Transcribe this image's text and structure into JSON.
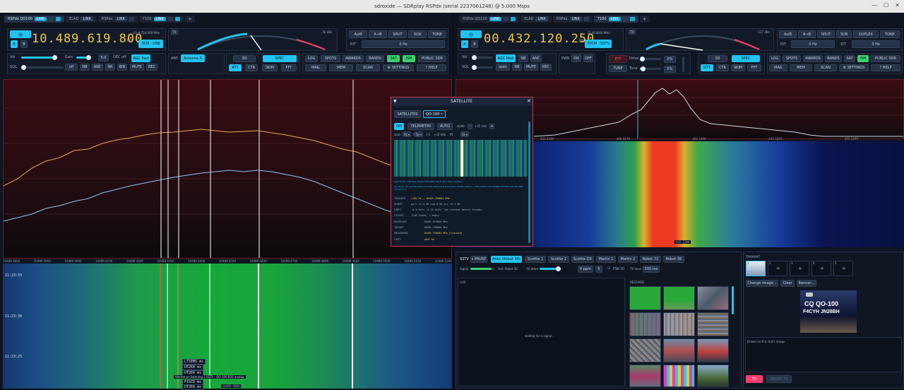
{
  "window": {
    "title": "sdroxide — SDRplay RSPdx (serial 2237061248) @ 5.000 Msps"
  },
  "left": {
    "tabs": [
      {
        "label": "RSPdx QO100",
        "link": "LINK",
        "active": true
      },
      {
        "label": "ELAD",
        "link": "LINK",
        "active": false
      },
      {
        "label": "RSPdx",
        "link": "LINK",
        "active": false
      },
      {
        "label": "7100",
        "link": "LINK",
        "active": false
      }
    ],
    "add_tab": "+",
    "vfo_a": "A",
    "vfo_b": "B",
    "frequency": "10.489.619.800",
    "freq_unit": "Hz",
    "sub_freq": "LO: 9.750.000 MHz",
    "tx_badge": "TX",
    "smeter_value": "-56 dBs",
    "band_button": "3CM · USB",
    "ab_buttons": [
      "A⇄B",
      "A→B",
      "SPLIT",
      "SUB",
      "TONE"
    ],
    "rit_label": "RIT",
    "rit_value": "0 Hz",
    "vol_label": "Vol",
    "gain_label": "Gain",
    "gain_value": "6.0",
    "dec_label": "DEC off",
    "agc_button": "AGC Fast",
    "sql_label": "SQL",
    "sql_value": "off",
    "nb": "NB",
    "anc": "ANC",
    "nr": "NR",
    "bin": "BIN",
    "mute": "MUTE",
    "rec": "REC",
    "ant_label": "ANT",
    "ant_button": "Antenna A",
    "view_buttons": [
      "3D",
      "SPEC",
      "RTT",
      "CTR",
      "SKIM",
      "FFT"
    ],
    "right_buttons": [
      "LOG",
      "SPOTS",
      "AWARDS",
      "BANDS",
      "SAT",
      "ISM",
      "PUBLIC SDR",
      "MAIL",
      "MEM",
      "SCAN",
      "⚙ SETTINGS",
      "? HELP"
    ],
    "spectrum_ticks": [
      "10489.3800",
      "10489.3900",
      "10489.4000",
      "10489.4100",
      "10489.4200",
      "10489.4300",
      "10489.4400",
      "10489.4500",
      "10489.4600",
      "10489.4700",
      "10489.4800",
      "10489.4900",
      "10489.5000",
      "10489.5100",
      "10489.5200"
    ],
    "time_labels": [
      "11:23:33",
      "11:23:30",
      "11:23:25"
    ],
    "spot_labels": [
      "LT1EMS ms",
      "UT2EA ms",
      "UT2EA ms",
      "F1SCD ms",
      "UT2EA ms",
      "UT2EA ms"
    ],
    "spot_tooltip": "Warten on listening 1 SSTV · QO-100 B20 analog",
    "cursor_readout": "10489.5000"
  },
  "right": {
    "tabs": [
      {
        "label": "RSPdx QO100",
        "link": "LINK",
        "active": false
      },
      {
        "label": "ELAD",
        "link": "LINK",
        "active": false
      },
      {
        "label": "RSPdx",
        "link": "LINK",
        "active": false
      },
      {
        "label": "7100",
        "link": "LINK",
        "active": true
      }
    ],
    "add_tab": "+",
    "vfo_a": "A",
    "vfo_b": "B",
    "frequency": "00.432.120.250",
    "freq_unit": "Hz",
    "sub_freq": "51.874000 MHz",
    "tx_badge": "TX",
    "smeter_value": "-127 dBs",
    "band_button": "70CM · SSTV",
    "ab_buttons": [
      "A⇄B",
      "A→B",
      "SPLIT",
      "SUB",
      "DUPLEX",
      "TONE"
    ],
    "rit_label": "RIT",
    "rit_value": "0 Hz",
    "xit_label": "XIT",
    "xit_value": "0 Hz",
    "vol_label": "Vol",
    "agc_button": "AGC Mod",
    "sql_label": "SQL",
    "sql_value": "open",
    "nb": "NB",
    "anc": "ANC",
    "mute": "MUTE",
    "rec": "REC",
    "pwr_label": "PWR",
    "pwr_on": "ON",
    "pwr_off": "OFF",
    "ptt": "PTT",
    "tune": "TUNE",
    "drive_label": "Drive",
    "drive_value": "0%",
    "tune_label": "Tune",
    "tune_value": "5%",
    "view_buttons": [
      "3D",
      "SPEC",
      "DTT",
      "CTR",
      "SKIM",
      "FFT"
    ],
    "right_buttons": [
      "LOG",
      "SPOTS",
      "AWARDS",
      "BANDS",
      "SAT",
      "ISM",
      "PUBLIC SDR",
      "MAIL",
      "MEM",
      "SCAN",
      "⚙ SETTINGS",
      "? HELP"
    ],
    "spectrum_ticks": [
      "432.1150",
      "432.1175",
      "432.1200",
      "432.1225",
      "432.1250"
    ],
    "cursor_readout": "432.1200"
  },
  "satellite": {
    "title": "SATELLITE",
    "tabs": [
      "SATELLITES",
      "QO-100 •"
    ],
    "on": "ON",
    "telemetry": "TELEMETRY",
    "auto": "AUTO",
    "width_label": "width",
    "width_value": "+25 kHz",
    "row2": [
      "span",
      "5k ▾",
      "fps",
      "5p ▾",
      "+5",
      "+32 kHz",
      "fft",
      "5k ▾"
    ],
    "note1": "searching — the first window fills after about 15 s, then repeats",
    "note2": "tip: if you can see the beacon in the strip but it won't lock, double-click it — that marks it as 10489.750 MHz and lets RPU correct to it",
    "rows": [
      {
        "k": "TRACKER",
        "v": "+185 Hz  →  10489.750604 MHz"
      },
      {
        "k": "SHAPE",
        "v": "wall 12.3 dB   sym 0.9k   snr 16.3 dB"
      },
      {
        "k": "DRIFT",
        "v": "-0.3 Hz/s   -0.12 Hz/s²  (de-rotated before decode)"
      },
      {
        "k": "CYCLES",
        "v": "1216 found, 1 empty"
      },
      {
        "k": "RECEIVED",
        "v": "10489.619800 MHz"
      },
      {
        "k": "TARGET",
        "v": "10489.750000 MHz"
      },
      {
        "k": "MEASURED",
        "v": "10489.750604 MHz  [tracked]"
      },
      {
        "k": "OSET",
        "v": "+604 Hz"
      }
    ]
  },
  "sstv": {
    "title": "SSTV",
    "pause": "PAUSE",
    "modes": [
      "Auto (Robot 36)",
      "Scottie 1",
      "Scottie 2",
      "Scottie DX",
      "Martin 1",
      "Martin 2",
      "Robot 72",
      "Robot 36"
    ],
    "signal_label": "Signal",
    "last_label": "last: Robot 36",
    "tx_label": "TX atten",
    "ppm_value": "0 ppm",
    "zero_value": "0",
    "fsk_label": "FSK ID",
    "tx_level_label": "TX level",
    "tx_level_value": "500 ms",
    "live_label": "LIVE",
    "waiting": "waiting for a signal…",
    "received_label": "RECEIVED",
    "transmit_label": "TRANSMIT",
    "slots": [
      "1",
      "2",
      "3",
      "4",
      "5"
    ],
    "slot_add": "+",
    "change_image": "Change image…",
    "clear": "Clear",
    "banner": "Banner…",
    "cq_line1": "CQ  QO-100",
    "cq_line2": "F4CYH JN26BH",
    "drawn_hint": "Drawn on this slot's image",
    "tx_button": "TX",
    "abort_button": "ABORT TX"
  },
  "colors": {
    "accent": "#22c4f0",
    "freq_yellow": "#f2c94c",
    "alert_pink": "#ff3d6f",
    "green": "#3ccf6e",
    "panel_border": "#c23b5a"
  }
}
